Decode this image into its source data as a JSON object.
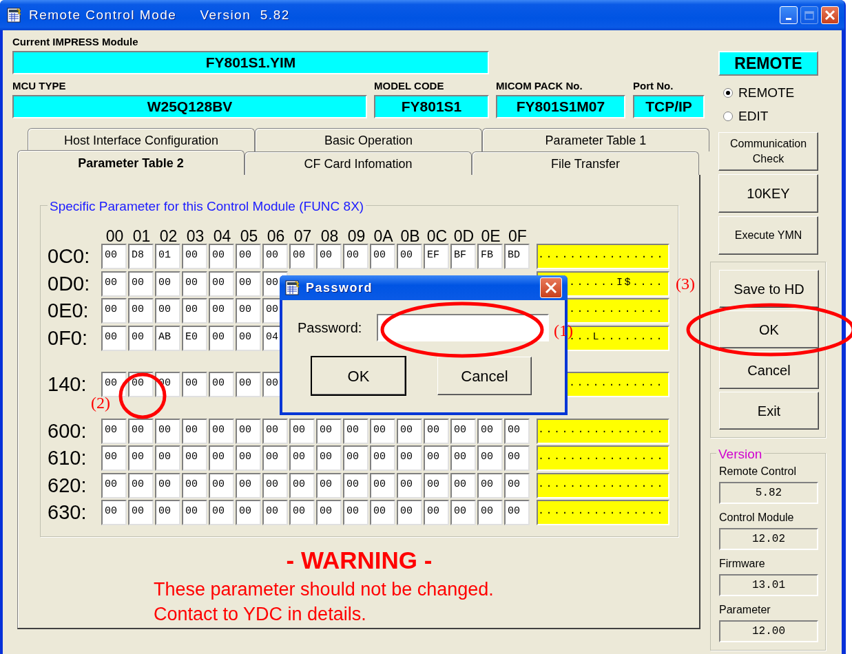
{
  "window": {
    "title": "Remote Control Mode",
    "version": "Version  5.82",
    "controls": [
      {
        "kind": "minimize",
        "disabled": false
      },
      {
        "kind": "maximize",
        "disabled": true
      },
      {
        "kind": "close",
        "disabled": false
      }
    ]
  },
  "module": {
    "label": "Current IMPRESS Module",
    "value": "FY801S1.YIM"
  },
  "info_fields": [
    {
      "label": "MCU TYPE",
      "value": "W25Q128BV"
    },
    {
      "label": "MODEL CODE",
      "value": "FY801S1"
    },
    {
      "label": "MICOM PACK No.",
      "value": "FY801S1M07"
    },
    {
      "label": "Port No.",
      "value": "TCP/IP"
    }
  ],
  "tab_rows": [
    [
      {
        "label": "Host Interface Configuration",
        "selected": false
      },
      {
        "label": "Basic Operation",
        "selected": false
      },
      {
        "label": "Parameter Table 1",
        "selected": false
      }
    ],
    [
      {
        "label": "Parameter Table 2",
        "selected": true
      },
      {
        "label": "CF Card Infomation",
        "selected": false
      },
      {
        "label": "File Transfer",
        "selected": false
      }
    ]
  ],
  "parameter_group": {
    "title": "Specific Parameter for this Control Module (FUNC 8X)",
    "columns": [
      "00",
      "01",
      "02",
      "03",
      "04",
      "05",
      "06",
      "07",
      "08",
      "09",
      "0A",
      "0B",
      "0C",
      "0D",
      "0E",
      "0F"
    ],
    "groups": [
      {
        "rows": [
          {
            "address": "0C0:",
            "cells": [
              "00",
              "D8",
              "01",
              "00",
              "00",
              "00",
              "00",
              "00",
              "00",
              "00",
              "00",
              "00",
              "EF",
              "BF",
              "FB",
              "BD"
            ],
            "ascii": "................"
          },
          {
            "address": "0D0:",
            "cells": [
              "00",
              "00",
              "00",
              "00",
              "00",
              "00",
              "00"
            ],
            "ascii": "......I$...."
          },
          {
            "address": "0E0:",
            "cells": [
              "00",
              "00",
              "00",
              "00",
              "00",
              "00",
              "00"
            ],
            "ascii": "............"
          },
          {
            "address": "0F0:",
            "cells": [
              "00",
              "00",
              "AB",
              "E0",
              "00",
              "00",
              "04"
            ],
            "ascii": "...L........"
          }
        ]
      },
      {
        "rows": [
          {
            "address": "140:",
            "cells": [
              "00",
              "00",
              "00",
              "00",
              "00",
              "00",
              "00"
            ],
            "ascii": "............"
          }
        ]
      },
      {
        "rows": [
          {
            "address": "600:",
            "cells": [
              "00",
              "00",
              "00",
              "00",
              "00",
              "00",
              "00",
              "00",
              "00",
              "00",
              "00",
              "00",
              "00",
              "00",
              "00",
              "00"
            ],
            "ascii": "................"
          },
          {
            "address": "610:",
            "cells": [
              "00",
              "00",
              "00",
              "00",
              "00",
              "00",
              "00",
              "00",
              "00",
              "00",
              "00",
              "00",
              "00",
              "00",
              "00",
              "00"
            ],
            "ascii": "................"
          },
          {
            "address": "620:",
            "cells": [
              "00",
              "00",
              "00",
              "00",
              "00",
              "00",
              "00",
              "00",
              "00",
              "00",
              "00",
              "00",
              "00",
              "00",
              "00",
              "00"
            ],
            "ascii": "................"
          },
          {
            "address": "630:",
            "cells": [
              "00",
              "00",
              "00",
              "00",
              "00",
              "00",
              "00",
              "00",
              "00",
              "00",
              "00",
              "00",
              "00",
              "00",
              "00",
              "00"
            ],
            "ascii": "................"
          }
        ]
      }
    ]
  },
  "warning": {
    "title": "- WARNING -",
    "lines": [
      "These parameter should not be changed.",
      "Contact to YDC in details."
    ]
  },
  "mode": {
    "indicator": "REMOTE",
    "options": [
      {
        "label": "REMOTE",
        "selected": true
      },
      {
        "label": "EDIT",
        "selected": false
      }
    ]
  },
  "tool_buttons": [
    "Communication Check",
    "10KEY",
    "Execute YMN"
  ],
  "action_buttons": [
    "Save to HD",
    "OK",
    "Cancel",
    "Exit"
  ],
  "version": {
    "title": "Version",
    "items": [
      {
        "label": "Remote Control",
        "value": "5.82"
      },
      {
        "label": "Control Module",
        "value": "12.02"
      },
      {
        "label": "Firmware",
        "value": "13.01"
      },
      {
        "label": "Parameter",
        "value": "12.00"
      }
    ]
  },
  "dialog": {
    "title": "Password",
    "field_label": "Password:",
    "buttons": [
      {
        "label": "OK",
        "default": true
      },
      {
        "label": "Cancel",
        "default": false
      }
    ]
  },
  "annotations": [
    {
      "label": "(1)"
    },
    {
      "label": "(2)"
    },
    {
      "label": "(3)"
    }
  ]
}
